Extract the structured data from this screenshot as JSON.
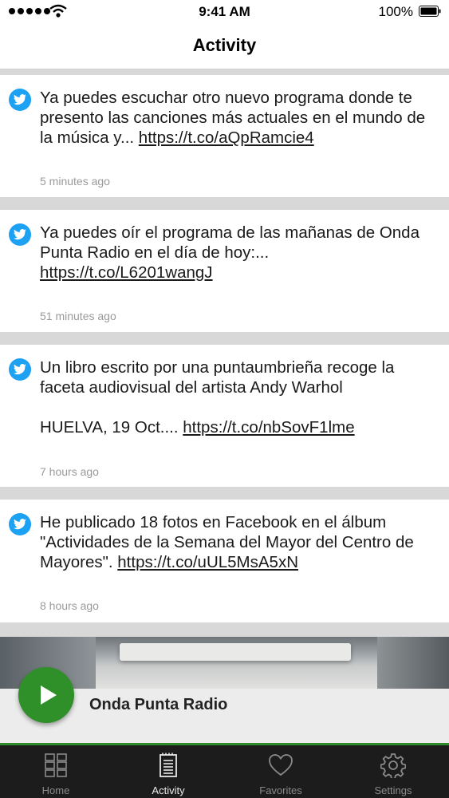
{
  "status_bar": {
    "time": "9:41 AM",
    "battery": "100%"
  },
  "nav": {
    "title": "Activity"
  },
  "feed": [
    {
      "text": "Ya puedes escuchar otro nuevo programa donde te presento las canciones más actuales en el mundo de la música y... ",
      "link": "https://t.co/aQpRamcie4",
      "time": "5 minutes ago"
    },
    {
      "text": "Ya puedes oír el programa de las mañanas de Onda Punta Radio en el día de hoy:... ",
      "link": "https://t.co/L6201wangJ",
      "time": "51 minutes ago"
    },
    {
      "text": "Un libro escrito por una puntaumbrieña recoge la faceta audiovisual del artista Andy Warhol\n\nHUELVA, 19 Oct.... ",
      "link": "https://t.co/nbSovF1lme",
      "time": "7 hours ago"
    },
    {
      "text": "He publicado 18 fotos en Facebook en el álbum \"Actividades de la Semana del Mayor del Centro de Mayores\". ",
      "link": "https://t.co/uUL5MsA5xN",
      "time": "8 hours ago"
    }
  ],
  "player": {
    "station": "Onda Punta Radio"
  },
  "tabs": [
    {
      "label": "Home",
      "icon": "grid-icon"
    },
    {
      "label": "Activity",
      "icon": "notepad-icon"
    },
    {
      "label": "Favorites",
      "icon": "heart-icon"
    },
    {
      "label": "Settings",
      "icon": "gear-icon"
    }
  ],
  "colors": {
    "twitter": "#1da1f2",
    "accent": "#2f8f29",
    "tab_bar": "#1c1c1c"
  }
}
